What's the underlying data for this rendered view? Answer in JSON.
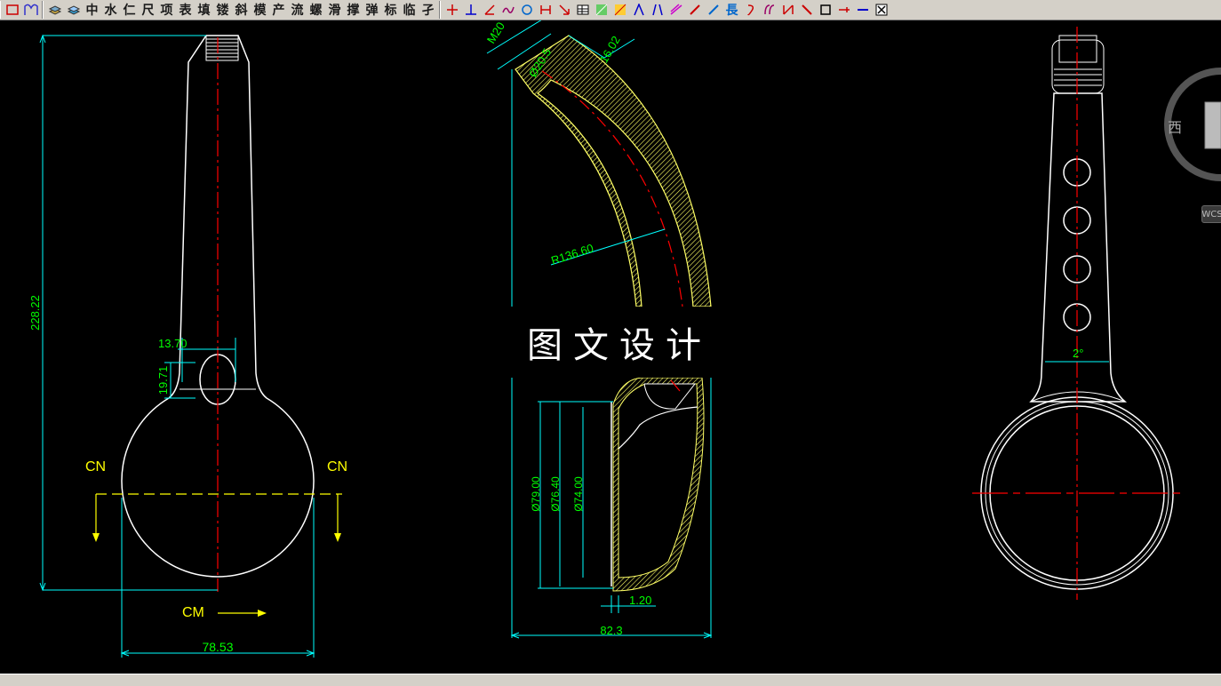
{
  "toolbar": {
    "text_tools": [
      "中",
      "水",
      "仁",
      "尺",
      "项",
      "表",
      "填",
      "镂",
      "斜",
      "模",
      "产",
      "流",
      "螺",
      "滑",
      "撑",
      "弹",
      "标",
      "临",
      "孑"
    ]
  },
  "watermark": "图文设计",
  "viewcube": {
    "west_label": "西",
    "wcs_label": "WCS"
  },
  "dimensions": {
    "front_height": "228.22",
    "front_hole_w": "13.70",
    "front_hole_h": "19.71",
    "front_width": "78.53",
    "section_left": "CN",
    "section_right": "CN",
    "section_cm": "CM",
    "side_thread": "M20",
    "side_bore": "Ø20.5",
    "side_top": "16.02",
    "side_radius": "R136.60",
    "side_d1": "Ø79.00",
    "side_d2": "Ø76.40",
    "side_d3": "Ø74.00",
    "side_wall": "1.20",
    "side_width": "82.3",
    "right_angle": "2°"
  },
  "colors": {
    "dimension": "#00ffff",
    "dim_text": "#00ff00",
    "outline": "#ffffff",
    "center": "#ff0000",
    "hatch": "#ffff66",
    "section": "#ffff00",
    "toolbar": "#d4d0c8"
  }
}
